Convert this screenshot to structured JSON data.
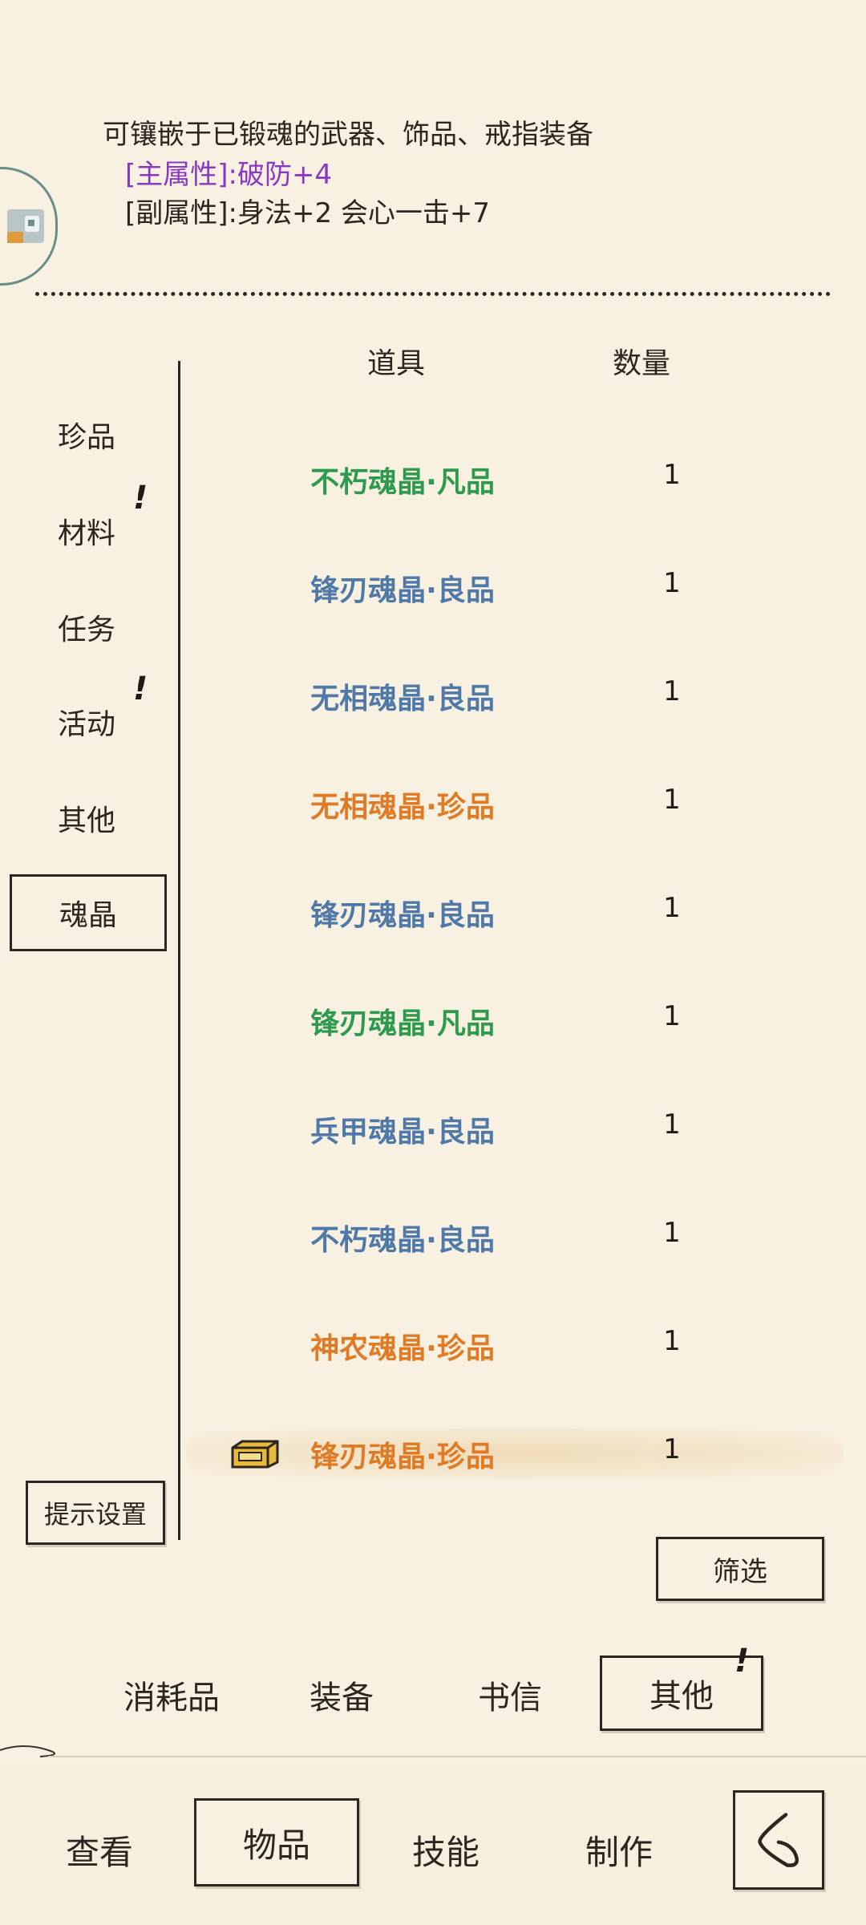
{
  "description": {
    "line1": "可镶嵌于已锻魂的武器、饰品、戒指装备",
    "line2": "[主属性]:破防+4",
    "line3": "[副属性]:身法+2 会心一击+7"
  },
  "columns": {
    "item": "道具",
    "quantity": "数量"
  },
  "categories": [
    {
      "label": "珍品"
    },
    {
      "label": "材料",
      "badge": "!"
    },
    {
      "label": "任务"
    },
    {
      "label": "活动",
      "badge": "!"
    },
    {
      "label": "其他"
    },
    {
      "label": "魂晶"
    }
  ],
  "items": [
    {
      "name": "不朽魂晶·凡品",
      "qty": "1",
      "color": "#2e9a4e"
    },
    {
      "name": "锋刃魂晶·良品",
      "qty": "1",
      "color": "#4f79a8"
    },
    {
      "name": "无相魂晶·良品",
      "qty": "1",
      "color": "#4f79a8"
    },
    {
      "name": "无相魂晶·珍品",
      "qty": "1",
      "color": "#e07a24"
    },
    {
      "name": "锋刃魂晶·良品",
      "qty": "1",
      "color": "#4f79a8"
    },
    {
      "name": "锋刃魂晶·凡品",
      "qty": "1",
      "color": "#2e9a4e"
    },
    {
      "name": "兵甲魂晶·良品",
      "qty": "1",
      "color": "#4f79a8"
    },
    {
      "name": "不朽魂晶·良品",
      "qty": "1",
      "color": "#4f79a8"
    },
    {
      "name": "神农魂晶·珍品",
      "qty": "1",
      "color": "#e07a24"
    },
    {
      "name": "锋刃魂晶·珍品",
      "qty": "1",
      "color": "#e07a24"
    }
  ],
  "buttons": {
    "hint_settings": "提示设置",
    "filter": "筛选"
  },
  "sub_tabs": [
    {
      "label": "消耗品"
    },
    {
      "label": "装备"
    },
    {
      "label": "书信"
    },
    {
      "label": "其他",
      "badge": "!"
    }
  ],
  "bottom_nav": [
    {
      "label": "查看"
    },
    {
      "label": "物品"
    },
    {
      "label": "技能"
    },
    {
      "label": "制作"
    }
  ],
  "colors": {
    "common": "#2e9a4e",
    "good": "#4f79a8",
    "rare": "#e07a24",
    "main_attr": "#8a38c4",
    "background": "#f8f1e2"
  }
}
